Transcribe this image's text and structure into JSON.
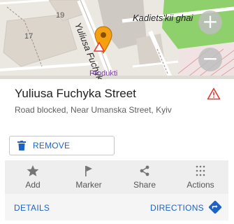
{
  "map": {
    "labels": {
      "house_19": "19",
      "house_17": "17",
      "street_vertical": "Yuliusa Fuchyka",
      "street_kadiets": "Kadiets'kii ghai",
      "poi": "Produkti"
    },
    "zoom_in": "+",
    "zoom_out": "−"
  },
  "place": {
    "title": "Yuliusa Fuchyka Street",
    "subtitle": "Road blocked, Near Umanska Street, Kyiv"
  },
  "remove_button": {
    "label": "REMOVE"
  },
  "actions": [
    {
      "label": "Add",
      "icon": "star-icon"
    },
    {
      "label": "Marker",
      "icon": "flag-icon"
    },
    {
      "label": "Share",
      "icon": "share-icon"
    },
    {
      "label": "Actions",
      "icon": "grid-dots-icon"
    }
  ],
  "bottom": {
    "details": "DETAILS",
    "directions": "DIRECTIONS"
  },
  "colors": {
    "accent": "#1e63c4",
    "pin": "#f5a010",
    "warning": "#e53935",
    "park": "#8ed06b"
  }
}
